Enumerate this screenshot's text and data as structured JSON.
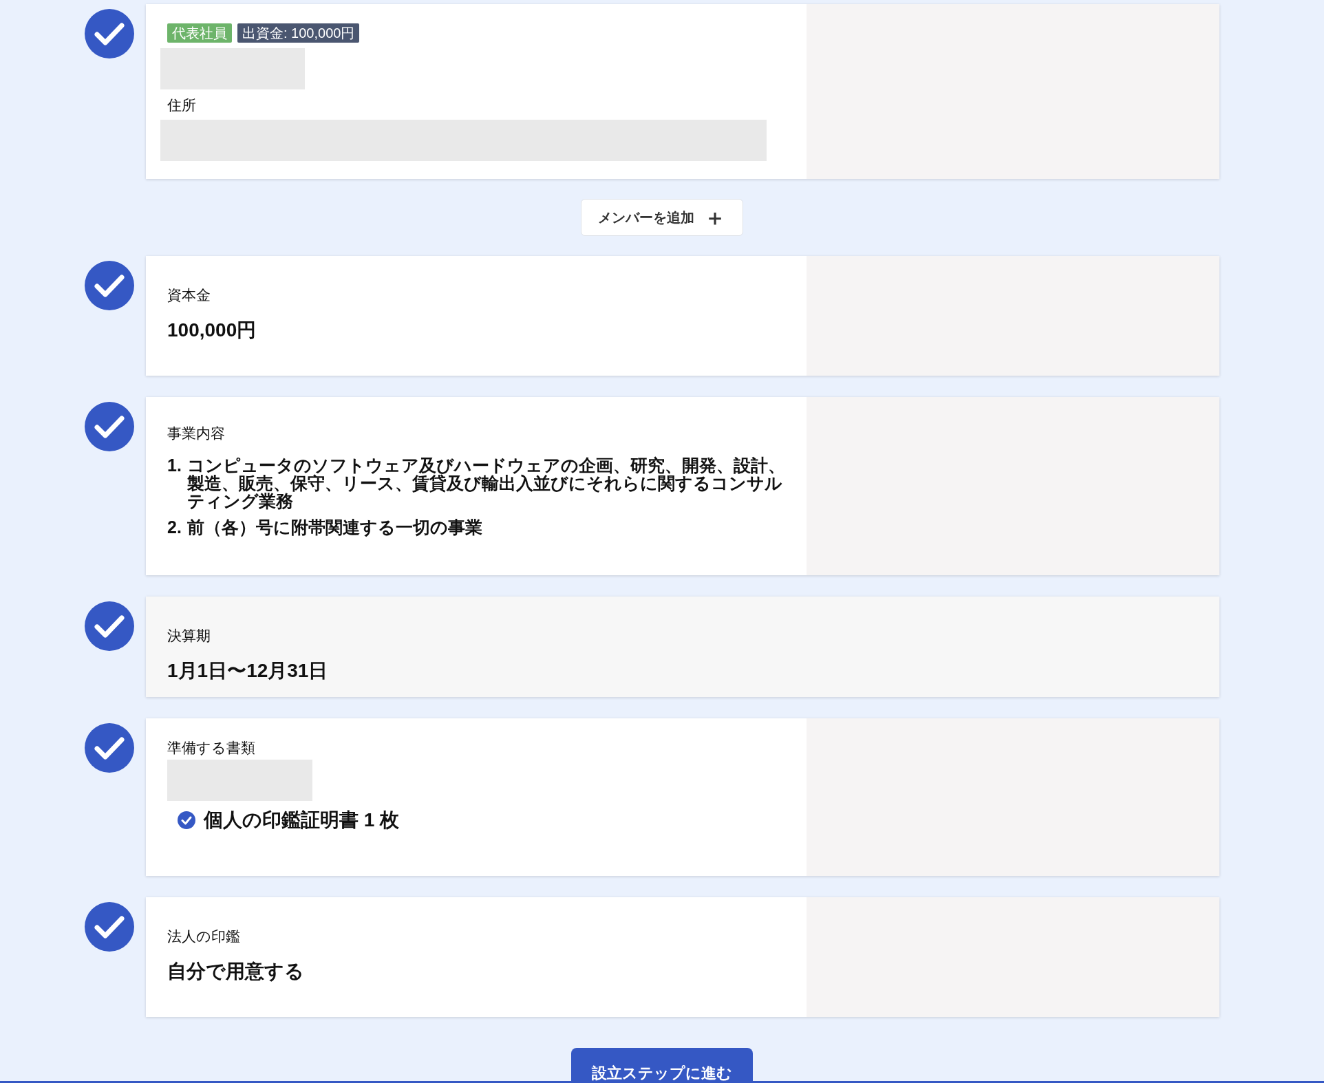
{
  "sections": [
    {
      "kind": "member",
      "done": true,
      "muted": false,
      "badges": [
        {
          "text": "代表社員",
          "color": "#6db46a"
        },
        {
          "text": "出資金: 100,000円",
          "color": "#4a5670"
        }
      ],
      "address_label": "住所"
    },
    {
      "kind": "add_button",
      "label": "メンバーを追加",
      "icon": "＋"
    },
    {
      "kind": "value",
      "done": true,
      "muted": false,
      "label": "資本金",
      "value": "100,000円"
    },
    {
      "kind": "list",
      "done": true,
      "muted": false,
      "label": "事業内容",
      "items": [
        {
          "number": "1.",
          "text": "コンピュータのソフトウェア及びハードウェアの企画、研究、開発、設計、製造、販売、保守、リース、賃貸及び輸出入並びにそれらに関するコンサルティング業務"
        },
        {
          "number": "2.",
          "text": "前（各）号に附帯関連する一切の事業"
        }
      ]
    },
    {
      "kind": "value",
      "done": true,
      "muted": true,
      "label": "決算期",
      "value": "1月1日〜12月31日"
    },
    {
      "kind": "documents",
      "done": true,
      "muted": false,
      "label": "準備する書類",
      "items": [
        {
          "text": "個人の印鑑証明書 1 枚",
          "checked": true
        }
      ]
    },
    {
      "kind": "value",
      "done": true,
      "muted": false,
      "label": "法人の印鑑",
      "value": "自分で用意する"
    }
  ],
  "submit_button": "設立ステップに進む"
}
